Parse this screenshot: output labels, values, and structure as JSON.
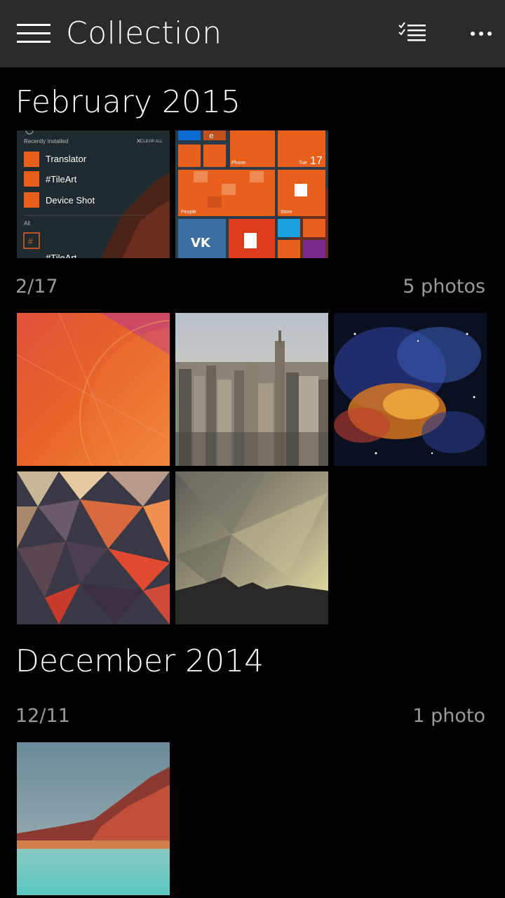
{
  "header": {
    "title": "Collection",
    "menu_icon": "hamburger-icon",
    "select_icon": "checklist-icon",
    "more_icon": "ellipsis-icon"
  },
  "groups": [
    {
      "month": "February 2015",
      "top_thumbs": [
        {
          "name": "start-apps-screenshot",
          "section_title": "Recently Installed",
          "clear_all": "CLEAR ALL",
          "apps": [
            "Translator",
            "#TileArt",
            "Device Shot"
          ],
          "all_label": "All",
          "hash_tile": "#",
          "partial_item": "#TileArt"
        },
        {
          "name": "start-tiles-screenshot",
          "tile_labels": {
            "phone": "Phone",
            "date_day": "Tue",
            "date_num": "17",
            "people": "People",
            "store": "Store"
          }
        }
      ],
      "date": "2/17",
      "count": "5 photos",
      "photos": [
        "orange-abstract",
        "city-skyline",
        "galaxy-nebula",
        "low-poly-red",
        "mountain-geometric"
      ]
    },
    {
      "month": "December 2014",
      "date": "12/11",
      "count": "1 photo",
      "photos": [
        "red-mountain-lake"
      ]
    }
  ],
  "colors": {
    "header_bg": "#2b2b2b",
    "background": "#000000",
    "accent_orange": "#e8601c",
    "secondary_text": "#9a9a9a"
  }
}
